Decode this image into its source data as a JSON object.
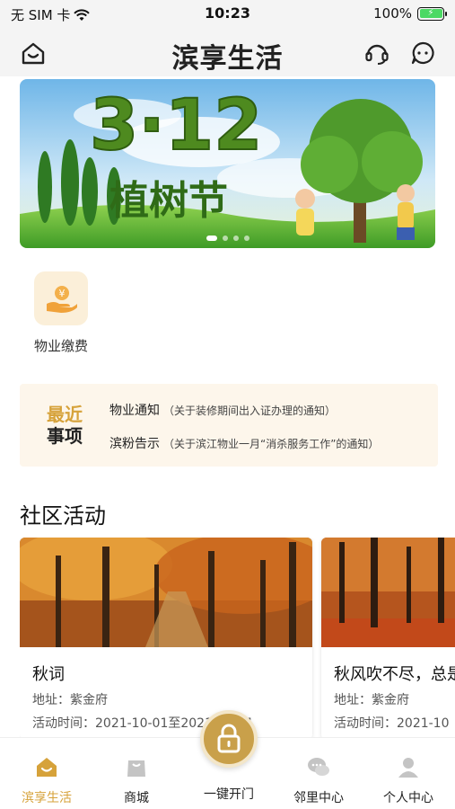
{
  "status_bar": {
    "carrier": "无 SIM 卡",
    "time": "10:23",
    "battery": "100%"
  },
  "header": {
    "title": "滨享生活"
  },
  "banner": {
    "title_number": "3·12",
    "title_text": "植树节"
  },
  "services": [
    {
      "label": "物业缴费",
      "icon": "hand-coin-icon"
    }
  ],
  "recent": {
    "tag_line1": "最近",
    "tag_line2": "事项",
    "items": [
      {
        "title": "物业通知",
        "detail": "（关于装修期间出入证办理的通知）"
      },
      {
        "title": "滨粉告示",
        "detail": "（关于滨江物业一月“消杀服务工作”的通知）"
      }
    ]
  },
  "community": {
    "section_title": "社区活动",
    "activities": [
      {
        "title": "秋词",
        "address": "地址：紫金府",
        "time": "活动时间：2021-10-01至2021-10-31"
      },
      {
        "title": "秋风吹不尽，总是",
        "address": "地址：紫金府",
        "time": "活动时间：2021-10"
      }
    ]
  },
  "tabbar": {
    "tabs": [
      {
        "label": "滨享生活",
        "icon": "home-icon",
        "active": true
      },
      {
        "label": "商城",
        "icon": "shopping-bag-icon",
        "active": false
      },
      {
        "label": "邻里中心",
        "icon": "chat-bubbles-icon",
        "active": false
      },
      {
        "label": "个人中心",
        "icon": "person-icon",
        "active": false
      }
    ],
    "door_label": "一键开门"
  },
  "colors": {
    "accent": "#d6a23a",
    "notice_bg": "#fdf6eb",
    "service_bg": "#fbefd9"
  }
}
